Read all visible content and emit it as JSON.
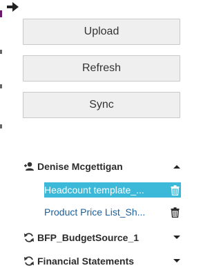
{
  "buttons": {
    "upload": "Upload",
    "refresh": "Refresh",
    "sync": "Sync"
  },
  "user_section": {
    "name": "Denise Mcgettigan",
    "icon": "user-icon",
    "expanded": true,
    "files": [
      {
        "label": "Headcount template_...",
        "selected": true,
        "icon": "trash-icon"
      },
      {
        "label": "Product Price List_Sh...",
        "selected": false,
        "icon": "trash-icon"
      }
    ]
  },
  "sources": [
    {
      "label": "BFP_BudgetSource_1",
      "icon": "sync-icon",
      "expanded": false
    },
    {
      "label": "Financial Statements",
      "icon": "sync-icon",
      "expanded": false
    }
  ],
  "colors": {
    "selected_bg": "#3cb8d8",
    "link": "#1a5e9a",
    "button_bg": "#efefef"
  }
}
